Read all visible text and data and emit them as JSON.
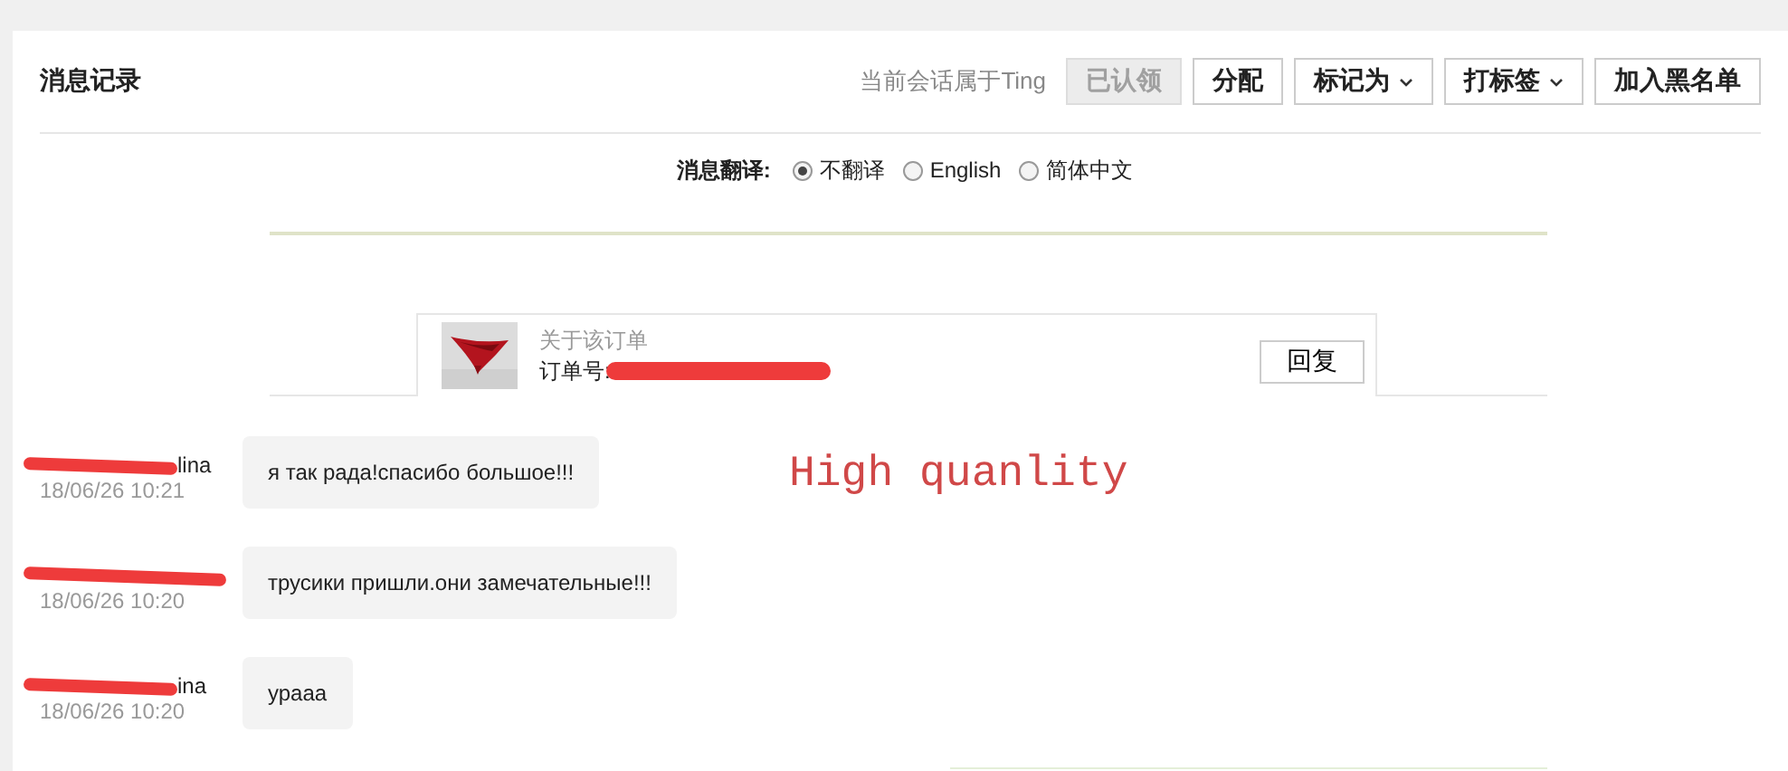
{
  "title": "消息记录",
  "owner_note": "当前会话属于Ting",
  "actions": [
    {
      "label": "已认领",
      "disabled": true,
      "dropdown": false
    },
    {
      "label": "分配",
      "disabled": false,
      "dropdown": false
    },
    {
      "label": "标记为",
      "disabled": false,
      "dropdown": true
    },
    {
      "label": "打标签",
      "disabled": false,
      "dropdown": true
    },
    {
      "label": "加入黑名单",
      "disabled": false,
      "dropdown": false
    }
  ],
  "translation": {
    "label": "消息翻译:",
    "options": [
      {
        "label": "不翻译",
        "selected": true
      },
      {
        "label": "English",
        "selected": false
      },
      {
        "label": "简体中文",
        "selected": false
      }
    ]
  },
  "order": {
    "heading": "关于该订单",
    "number_label": "订单号:",
    "reply_button": "回复"
  },
  "messages": [
    {
      "sender": "lina",
      "time": "18/06/26 10:21",
      "text": "я так рада!спасибо большое!!!"
    },
    {
      "time": "18/06/26 10:20",
      "text": "трусики пришли.они замечательные!!!"
    },
    {
      "sender": "ina",
      "time": "18/06/26 10:20",
      "text": "ураaa"
    }
  ],
  "annotation": "High quanlity"
}
